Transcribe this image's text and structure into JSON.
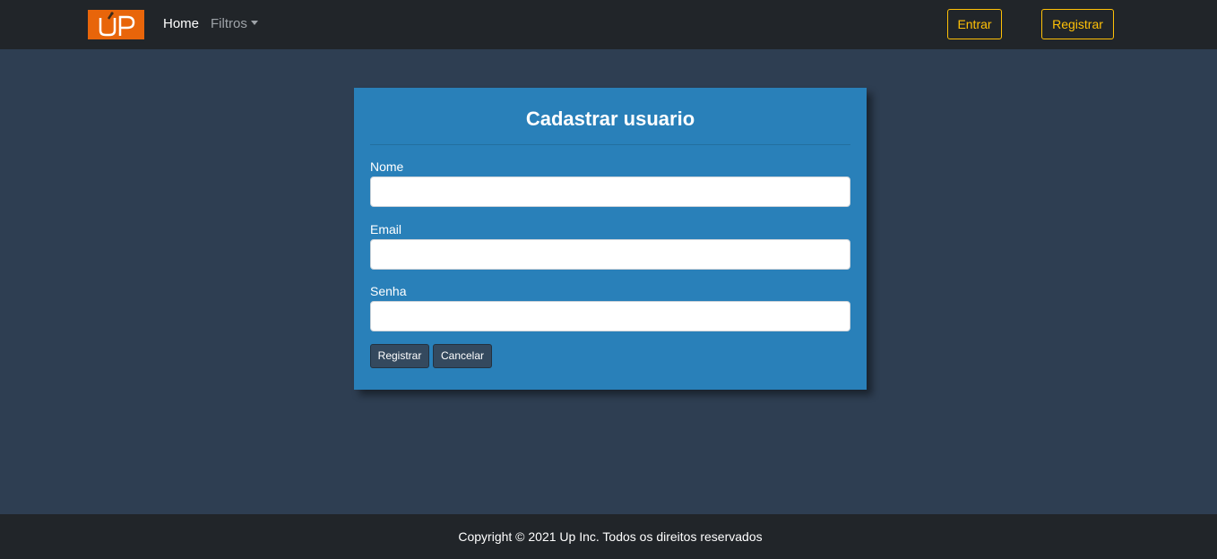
{
  "navbar": {
    "logo_text": "UP",
    "links": {
      "home": "Home",
      "filtros": "Filtros"
    },
    "buttons": {
      "entrar": "Entrar",
      "registrar": "Registrar"
    },
    "accent_color": "#ffc107"
  },
  "form": {
    "title": "Cadastrar usuario",
    "fields": {
      "nome": {
        "label": "Nome",
        "value": ""
      },
      "email": {
        "label": "Email",
        "value": ""
      },
      "senha": {
        "label": "Senha",
        "value": ""
      }
    },
    "buttons": {
      "registrar": "Registrar",
      "cancelar": "Cancelar"
    },
    "card_color": "#2980b9"
  },
  "footer": {
    "copyright": "Copyright © 2021 Up Inc. Todos os direitos reservados"
  },
  "colors": {
    "background": "#2e3e52",
    "navbar": "#212529",
    "logo": "#e8650a"
  }
}
